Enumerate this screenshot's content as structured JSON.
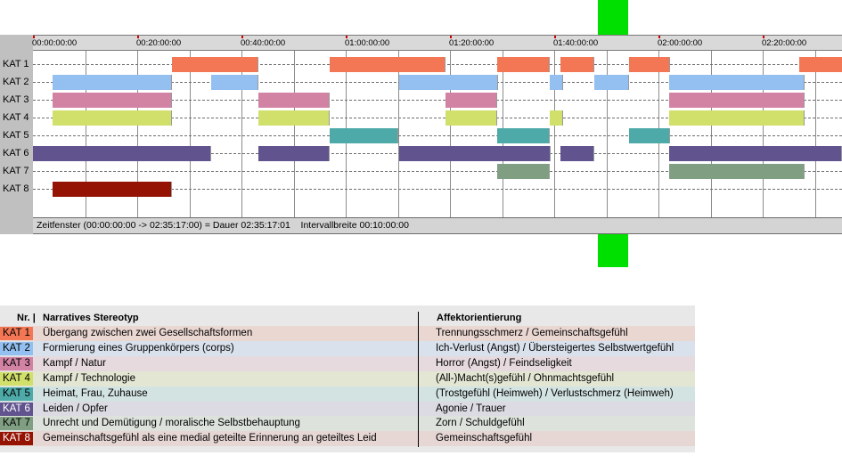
{
  "axis": {
    "ticks": [
      "00:00:00:00",
      "00:20:00:00",
      "00:40:00:00",
      "01:00:00:00",
      "01:20:00:00",
      "01:40:00:00",
      "02:00:00:00",
      "02:20:00:00"
    ]
  },
  "categories": [
    {
      "label": "KAT 1",
      "color": "#f47755",
      "tag_text": "#000000"
    },
    {
      "label": "KAT 2",
      "color": "#93c0f0",
      "tag_text": "#000000"
    },
    {
      "label": "KAT 3",
      "color": "#d283a4",
      "tag_text": "#000000"
    },
    {
      "label": "KAT 4",
      "color": "#d1e06a",
      "tag_text": "#000000"
    },
    {
      "label": "KAT 5",
      "color": "#4daaa8",
      "tag_text": "#000000"
    },
    {
      "label": "KAT 6",
      "color": "#60538e",
      "tag_text": "#ffffff"
    },
    {
      "label": "KAT 7",
      "color": "#809f82",
      "tag_text": "#000000"
    },
    {
      "label": "KAT 8",
      "color": "#951303",
      "tag_text": "#ffffff"
    }
  ],
  "segments_minutes": [
    [
      [
        26.7,
        43.3
      ],
      [
        57.0,
        79.2
      ],
      [
        89.1,
        99.2
      ],
      [
        101.2,
        107.7
      ],
      [
        114.3,
        122.1
      ],
      [
        147.0,
        155.3
      ]
    ],
    [
      [
        3.8,
        26.7
      ],
      [
        34.2,
        43.3
      ],
      [
        70.2,
        89.1
      ],
      [
        99.2,
        101.7
      ],
      [
        107.7,
        114.3
      ],
      [
        122.1,
        148.0
      ]
    ],
    [
      [
        3.8,
        26.7
      ],
      [
        43.3,
        57.0
      ],
      [
        79.2,
        89.1
      ],
      [
        122.1,
        148.0
      ]
    ],
    [
      [
        3.8,
        26.7
      ],
      [
        43.3,
        57.0
      ],
      [
        79.2,
        89.1
      ],
      [
        99.2,
        101.7
      ],
      [
        122.1,
        148.0
      ]
    ],
    [
      [
        57.0,
        70.2
      ],
      [
        89.1,
        99.2
      ],
      [
        114.3,
        122.1
      ]
    ],
    [
      [
        0,
        34.2
      ],
      [
        43.3,
        57.0
      ],
      [
        70.2,
        99.2
      ],
      [
        101.2,
        107.7
      ],
      [
        122.1,
        155.3
      ]
    ],
    [
      [
        89.1,
        99.2
      ],
      [
        122.1,
        148.0
      ]
    ],
    [
      [
        3.8,
        26.7
      ]
    ]
  ],
  "status": {
    "text": "Zeitfenster (00:00:00:00 -> 02:35:17:00) = Dauer 02:35:17:01    Intervallbreite 00:10:00:00"
  },
  "legend": {
    "headers": {
      "nr": "Nr. |",
      "stereotyp": "Narratives Stereotyp",
      "affekt": "Affektorientierung"
    },
    "rows": [
      {
        "kat": "KAT 1",
        "stereotyp": "Übergang zwischen zwei Gesellschaftsformen",
        "affekt": "Trennungsschmerz / Gemeinschaftsgefühl",
        "bg": "#ead7d2"
      },
      {
        "kat": "KAT 2",
        "stereotyp": "Formierung eines Gruppenkörpers (corps)",
        "affekt": "Ich-Verlust (Angst) / Übersteigertes Selbstwertgefühl",
        "bg": "#d9e1ec"
      },
      {
        "kat": "KAT 3",
        "stereotyp": "Kampf / Natur",
        "affekt": "Horror (Angst) / Feindseligkeit",
        "bg": "#e6dadf"
      },
      {
        "kat": "KAT 4",
        "stereotyp": "Kampf / Technologie",
        "affekt": "(All-)Macht(s)gefühl / Ohnmachtsgefühl",
        "bg": "#e3e6d3"
      },
      {
        "kat": "KAT 5",
        "stereotyp": "Heimat, Frau, Zuhause",
        "affekt": "(Trostgefühl (Heimweh) / Verlustschmerz (Heimweh)",
        "bg": "#d3e3e2"
      },
      {
        "kat": "KAT 6",
        "stereotyp": "Leiden / Opfer",
        "affekt": "Agonie / Trauer",
        "bg": "#dcdae2"
      },
      {
        "kat": "KAT 7",
        "stereotyp": "Unrecht und Demütigung / moralische Selbstbehauptung",
        "affekt": "Zorn / Schuldgefühl",
        "bg": "#dde3dc"
      },
      {
        "kat": "KAT 8",
        "stereotyp": "Gemeinschaftsgefühl als eine medial geteilte Erinnerung an geteiltes Leid",
        "affekt": "Gemeinschaftsgefühl",
        "bg": "#e6d6d4"
      }
    ]
  }
}
